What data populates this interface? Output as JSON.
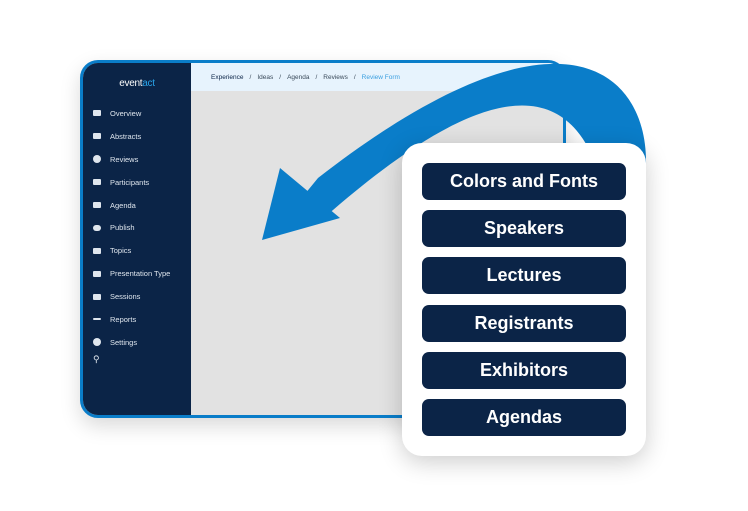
{
  "app": {
    "logo": "eventact",
    "logo_a": "event",
    "logo_b": "act"
  },
  "breadcrumb": [
    "Experience",
    "Ideas",
    "Agenda",
    "Reviews",
    "Review Form"
  ],
  "sidebar": {
    "items": [
      {
        "label": "Overview",
        "icon": "overview-icon"
      },
      {
        "label": "Abstracts",
        "icon": "abstracts-icon"
      },
      {
        "label": "Reviews",
        "icon": "badge-check-icon"
      },
      {
        "label": "Participants",
        "icon": "users-icon"
      },
      {
        "label": "Agenda",
        "icon": "agenda-icon"
      },
      {
        "label": "Publish",
        "icon": "cloud-upload-icon"
      },
      {
        "label": "Topics",
        "icon": "sitemap-icon"
      },
      {
        "label": "Presentation Type",
        "icon": "presentation-icon"
      },
      {
        "label": "Sessions",
        "icon": "monitor-icon"
      },
      {
        "label": "Reports",
        "icon": "trend-icon"
      },
      {
        "label": "Settings",
        "icon": "gear-icon"
      }
    ],
    "search_icon": "search-icon"
  },
  "card": {
    "buttons": [
      "Colors and Fonts",
      "Speakers",
      "Lectures",
      "Registrants",
      "Exhibitors",
      "Agendas"
    ]
  },
  "colors": {
    "navy": "#0b2447",
    "blue": "#0a7dc9"
  }
}
